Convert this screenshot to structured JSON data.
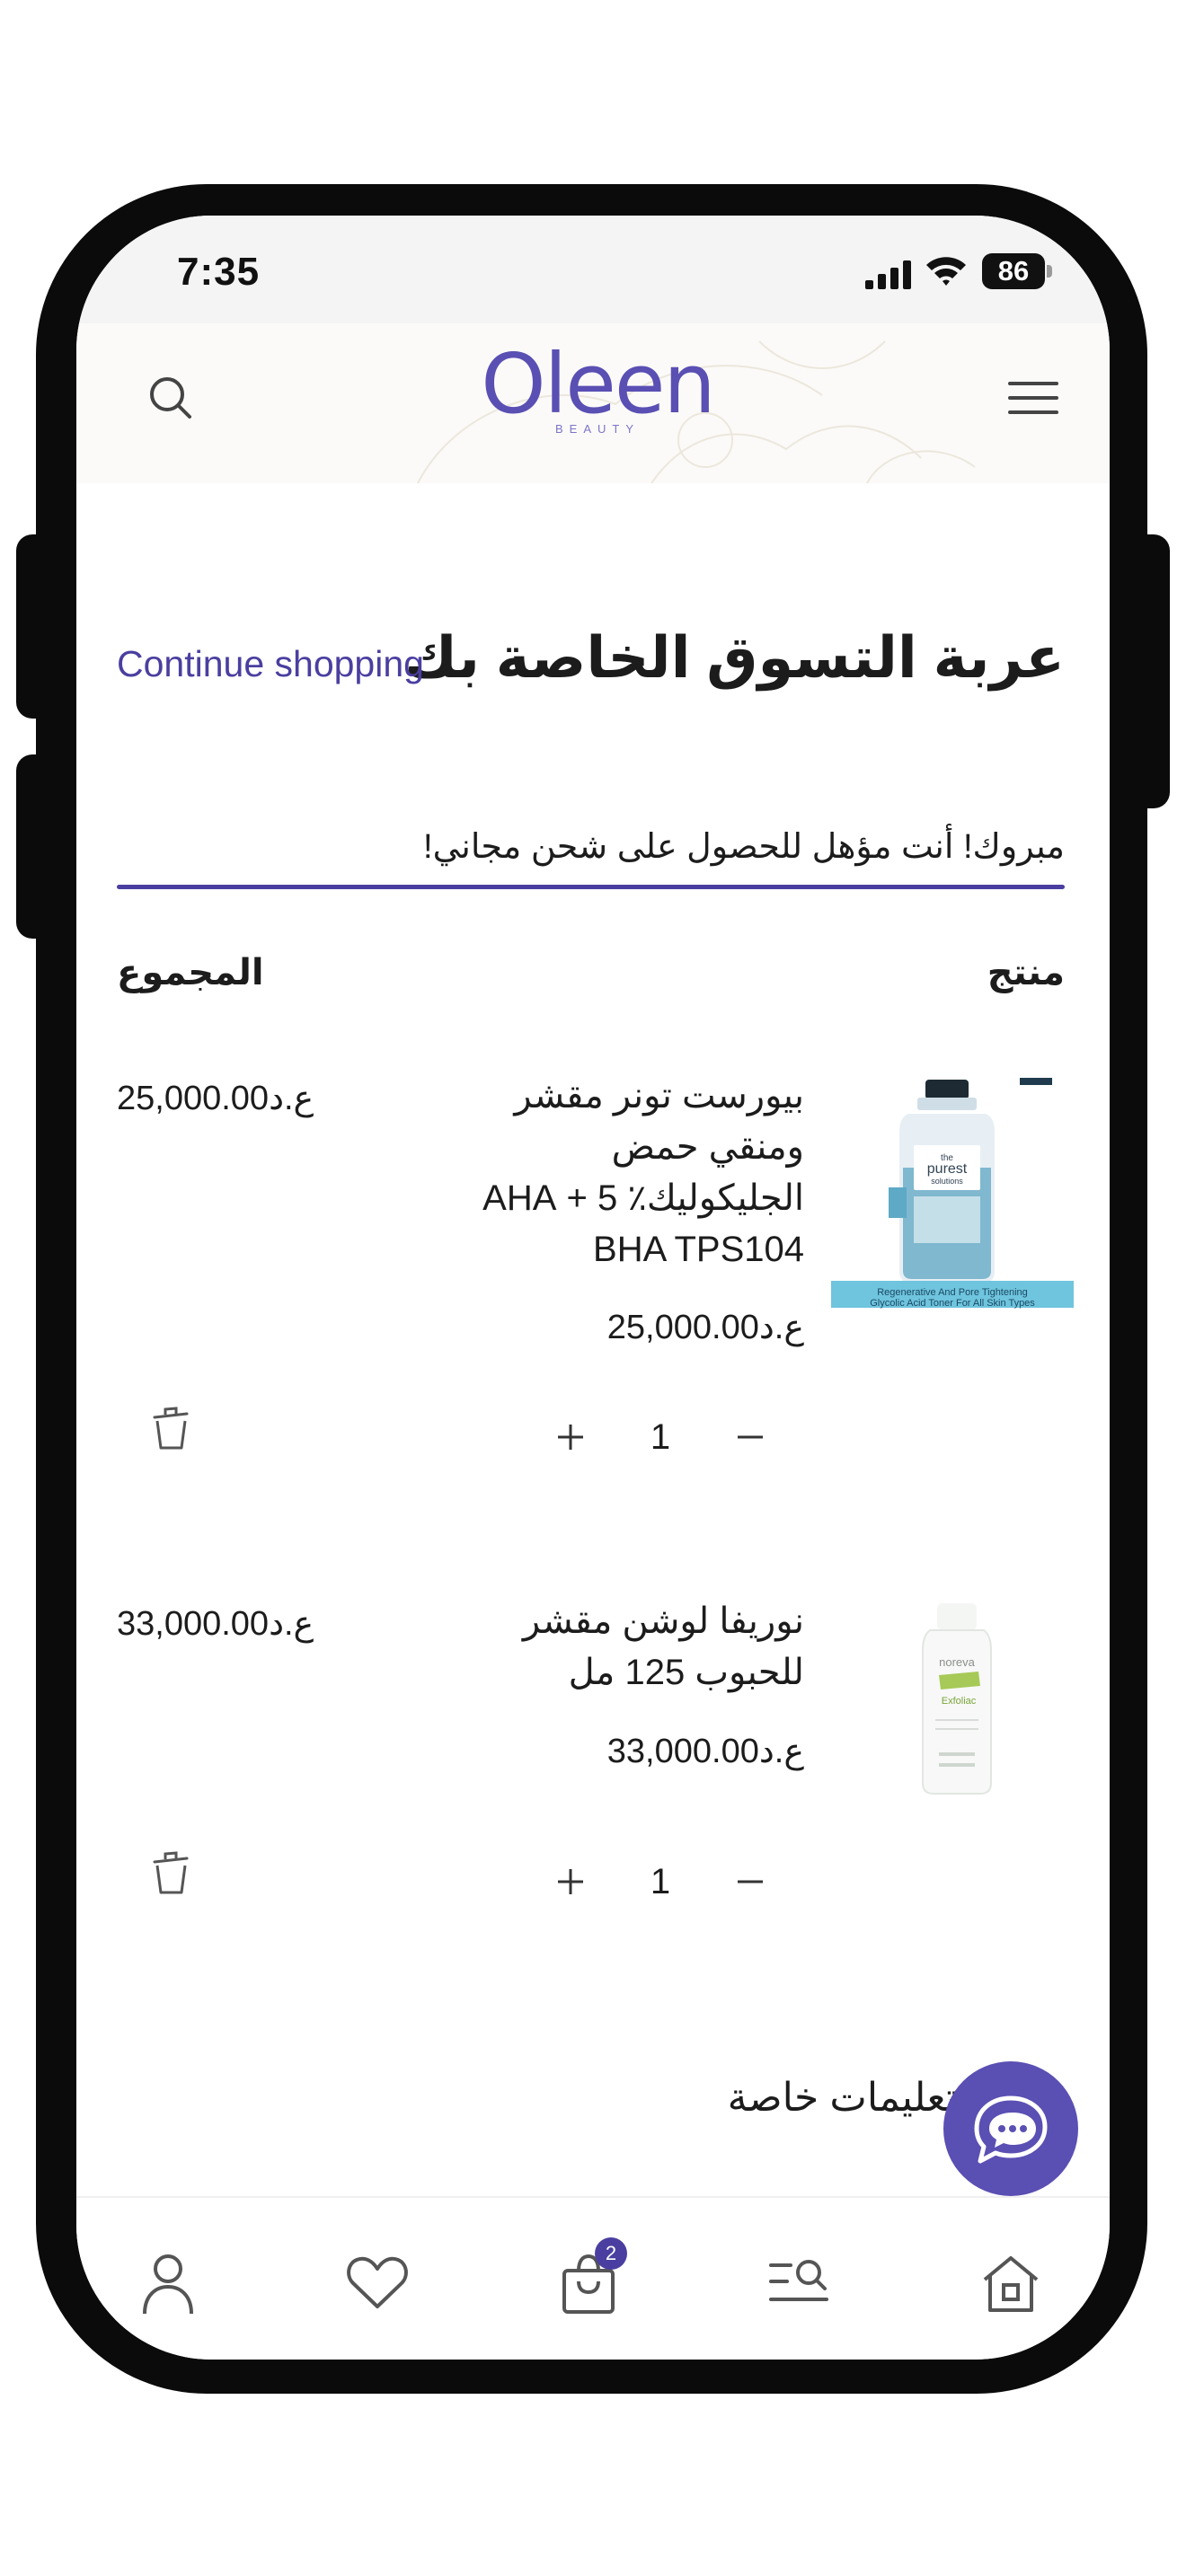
{
  "status_bar": {
    "time": "7:35",
    "battery": "86",
    "icons": [
      "signal-icon",
      "wifi-icon",
      "battery-icon"
    ]
  },
  "header": {
    "logo_text": "Oleen",
    "logo_subtext": "BEAUTY",
    "icons": [
      "search-icon",
      "menu-icon"
    ]
  },
  "cart": {
    "title": "عربة التسوق الخاصة بك",
    "continue_label": "Continue shopping",
    "free_shipping_message": "مبروك! أنت مؤهل للحصول على شحن مجاني!",
    "free_shipping_progress": 1.0,
    "col_product": "منتج",
    "col_total": "المجموع",
    "items": [
      {
        "title": "بيورست تونر مقشر ومنقي حمض الجليكوليك٪ 5 + AHA BHA TPS104",
        "price": "25,000.00ع.د",
        "quantity": "1",
        "total": "25,000.00ع.د",
        "image_label": "Regenerative And Pore Tightening Glycolic Acid Toner For All Skin Types",
        "image_brand": "the purest solutions",
        "icons": [
          "plus-icon",
          "minus-icon",
          "trash-icon"
        ]
      },
      {
        "title": "نوريفا لوشن مقشر للحبوب 125 مل",
        "price": "33,000.00ع.د",
        "quantity": "1",
        "total": "33,000.00ع.د",
        "image_brand": "noreva",
        "image_product": "Exfoliac",
        "icons": [
          "plus-icon",
          "minus-icon",
          "trash-icon"
        ]
      }
    ],
    "special_instructions": "تعليمات خاصة"
  },
  "bottom_nav": {
    "items": [
      "account-icon",
      "wishlist-icon",
      "cart-icon",
      "search-list-icon",
      "home-icon"
    ],
    "cart_count": "2"
  },
  "colors": {
    "brand": "#5a4fb3",
    "accent": "#4a3fa0",
    "text": "#1c1c1c"
  }
}
